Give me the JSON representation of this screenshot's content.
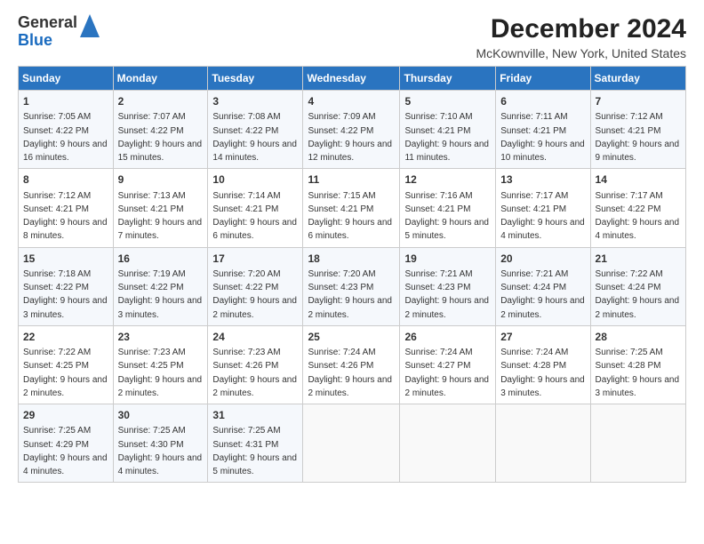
{
  "logo": {
    "line1": "General",
    "line2": "Blue"
  },
  "title": "December 2024",
  "subtitle": "McKownville, New York, United States",
  "days_of_week": [
    "Sunday",
    "Monday",
    "Tuesday",
    "Wednesday",
    "Thursday",
    "Friday",
    "Saturday"
  ],
  "weeks": [
    [
      {
        "day": "1",
        "sunrise": "7:05 AM",
        "sunset": "4:22 PM",
        "daylight": "9 hours and 16 minutes."
      },
      {
        "day": "2",
        "sunrise": "7:07 AM",
        "sunset": "4:22 PM",
        "daylight": "9 hours and 15 minutes."
      },
      {
        "day": "3",
        "sunrise": "7:08 AM",
        "sunset": "4:22 PM",
        "daylight": "9 hours and 14 minutes."
      },
      {
        "day": "4",
        "sunrise": "7:09 AM",
        "sunset": "4:22 PM",
        "daylight": "9 hours and 12 minutes."
      },
      {
        "day": "5",
        "sunrise": "7:10 AM",
        "sunset": "4:21 PM",
        "daylight": "9 hours and 11 minutes."
      },
      {
        "day": "6",
        "sunrise": "7:11 AM",
        "sunset": "4:21 PM",
        "daylight": "9 hours and 10 minutes."
      },
      {
        "day": "7",
        "sunrise": "7:12 AM",
        "sunset": "4:21 PM",
        "daylight": "9 hours and 9 minutes."
      }
    ],
    [
      {
        "day": "8",
        "sunrise": "7:12 AM",
        "sunset": "4:21 PM",
        "daylight": "9 hours and 8 minutes."
      },
      {
        "day": "9",
        "sunrise": "7:13 AM",
        "sunset": "4:21 PM",
        "daylight": "9 hours and 7 minutes."
      },
      {
        "day": "10",
        "sunrise": "7:14 AM",
        "sunset": "4:21 PM",
        "daylight": "9 hours and 6 minutes."
      },
      {
        "day": "11",
        "sunrise": "7:15 AM",
        "sunset": "4:21 PM",
        "daylight": "9 hours and 6 minutes."
      },
      {
        "day": "12",
        "sunrise": "7:16 AM",
        "sunset": "4:21 PM",
        "daylight": "9 hours and 5 minutes."
      },
      {
        "day": "13",
        "sunrise": "7:17 AM",
        "sunset": "4:21 PM",
        "daylight": "9 hours and 4 minutes."
      },
      {
        "day": "14",
        "sunrise": "7:17 AM",
        "sunset": "4:22 PM",
        "daylight": "9 hours and 4 minutes."
      }
    ],
    [
      {
        "day": "15",
        "sunrise": "7:18 AM",
        "sunset": "4:22 PM",
        "daylight": "9 hours and 3 minutes."
      },
      {
        "day": "16",
        "sunrise": "7:19 AM",
        "sunset": "4:22 PM",
        "daylight": "9 hours and 3 minutes."
      },
      {
        "day": "17",
        "sunrise": "7:20 AM",
        "sunset": "4:22 PM",
        "daylight": "9 hours and 2 minutes."
      },
      {
        "day": "18",
        "sunrise": "7:20 AM",
        "sunset": "4:23 PM",
        "daylight": "9 hours and 2 minutes."
      },
      {
        "day": "19",
        "sunrise": "7:21 AM",
        "sunset": "4:23 PM",
        "daylight": "9 hours and 2 minutes."
      },
      {
        "day": "20",
        "sunrise": "7:21 AM",
        "sunset": "4:24 PM",
        "daylight": "9 hours and 2 minutes."
      },
      {
        "day": "21",
        "sunrise": "7:22 AM",
        "sunset": "4:24 PM",
        "daylight": "9 hours and 2 minutes."
      }
    ],
    [
      {
        "day": "22",
        "sunrise": "7:22 AM",
        "sunset": "4:25 PM",
        "daylight": "9 hours and 2 minutes."
      },
      {
        "day": "23",
        "sunrise": "7:23 AM",
        "sunset": "4:25 PM",
        "daylight": "9 hours and 2 minutes."
      },
      {
        "day": "24",
        "sunrise": "7:23 AM",
        "sunset": "4:26 PM",
        "daylight": "9 hours and 2 minutes."
      },
      {
        "day": "25",
        "sunrise": "7:24 AM",
        "sunset": "4:26 PM",
        "daylight": "9 hours and 2 minutes."
      },
      {
        "day": "26",
        "sunrise": "7:24 AM",
        "sunset": "4:27 PM",
        "daylight": "9 hours and 2 minutes."
      },
      {
        "day": "27",
        "sunrise": "7:24 AM",
        "sunset": "4:28 PM",
        "daylight": "9 hours and 3 minutes."
      },
      {
        "day": "28",
        "sunrise": "7:25 AM",
        "sunset": "4:28 PM",
        "daylight": "9 hours and 3 minutes."
      }
    ],
    [
      {
        "day": "29",
        "sunrise": "7:25 AM",
        "sunset": "4:29 PM",
        "daylight": "9 hours and 4 minutes."
      },
      {
        "day": "30",
        "sunrise": "7:25 AM",
        "sunset": "4:30 PM",
        "daylight": "9 hours and 4 minutes."
      },
      {
        "day": "31",
        "sunrise": "7:25 AM",
        "sunset": "4:31 PM",
        "daylight": "9 hours and 5 minutes."
      },
      null,
      null,
      null,
      null
    ]
  ],
  "labels": {
    "sunrise": "Sunrise:",
    "sunset": "Sunset:",
    "daylight": "Daylight:"
  }
}
